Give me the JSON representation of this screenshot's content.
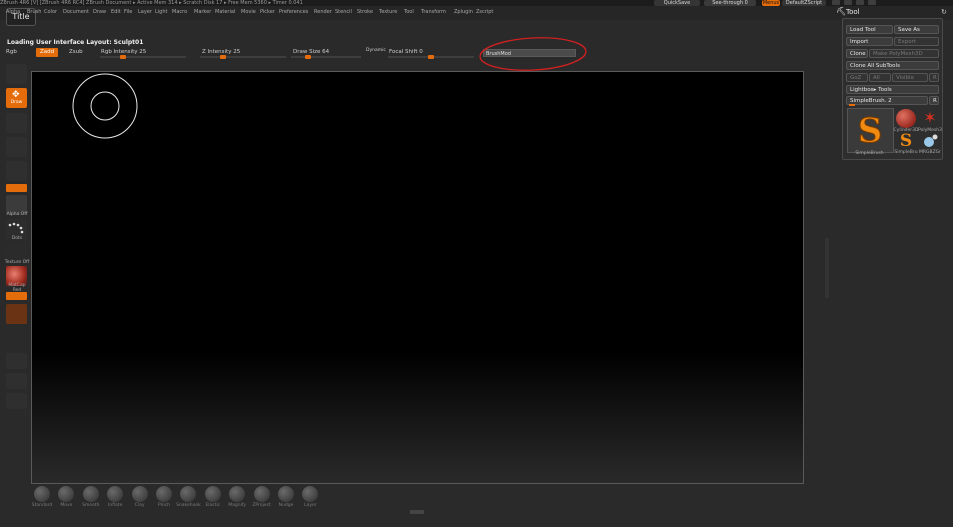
{
  "window": {
    "titlebar_text": "ZBrush 4R6 [V] [ZBrush 4R6 RC4]   ZBrush Document    ▸ Active Mem 314 ▸ Scratch Disk 17 ▸ Free Mem 5360 ▸ Timer 0.041",
    "title_button": "Title"
  },
  "menubar": {
    "items": [
      "Alpha",
      "Brush",
      "Color",
      "Document",
      "Draw",
      "Edit",
      "File",
      "Layer",
      "Light",
      "Macro",
      "Marker",
      "Material",
      "Movie",
      "Picker",
      "Preferences",
      "Render",
      "Stencil",
      "Stroke",
      "Texture",
      "Tool",
      "Transform",
      "Zplugin",
      "Zscript"
    ],
    "quicksave": "QuickSave",
    "see_through": "See-through 0",
    "menus": "Menus",
    "default_script": "DefaultZScript"
  },
  "toolbar": {
    "status": "Loading User Interface Layout: Sculpt01",
    "rgb": "Rgb",
    "zadd": "Zadd",
    "zsub": "Zsub",
    "rgb_intensity": "Rgb Intensity 25",
    "z_intensity": "Z Intensity 25",
    "draw_size": "Draw Size 64",
    "dynamic": "Dynamic",
    "focal_shift": "Focal Shift 0",
    "field_value": "BrushMod",
    "slider_levels": {
      "rgb_intensity": 25,
      "z_intensity": 25,
      "draw_size": 64,
      "focal_shift": 0
    }
  },
  "shelf": {
    "draw_label": "Draw",
    "alpha_label": "Alpha Off",
    "stroke_label": "Dots",
    "texture_label": "Texture Off",
    "material_label": "MatCap Red"
  },
  "brushes": [
    "Standard",
    "Move",
    "Smooth",
    "Inflate",
    "Clay",
    "Pinch",
    "Snakehook",
    "Elastic",
    "Magnify",
    "ZProject",
    "Nudge",
    "Layer"
  ],
  "tool_panel": {
    "title": "Tool",
    "load_tool": "Load Tool",
    "save_as": "Save As",
    "import": "Import",
    "export": "Export",
    "clone": "Clone",
    "make_polymesh": "Make PolyMesh3D",
    "clone_all": "Clone All SubTools",
    "goz": "GoZ",
    "all": "All",
    "visible": "Visible",
    "r1": "R",
    "lightbox_tools": "Lightbox▸ Tools",
    "current_tool": "SimpleBrush. 2",
    "r2": "R",
    "thumbs": {
      "main": "SimpleBrush",
      "cylinder": "Cylinder3D",
      "polymesh": "PolyMesh3",
      "simplebrush": "SimpleBru",
      "mrgb": "MRGBZGr"
    }
  },
  "colors": {
    "accent": "#e46c0a",
    "annotation": "#d42020"
  }
}
